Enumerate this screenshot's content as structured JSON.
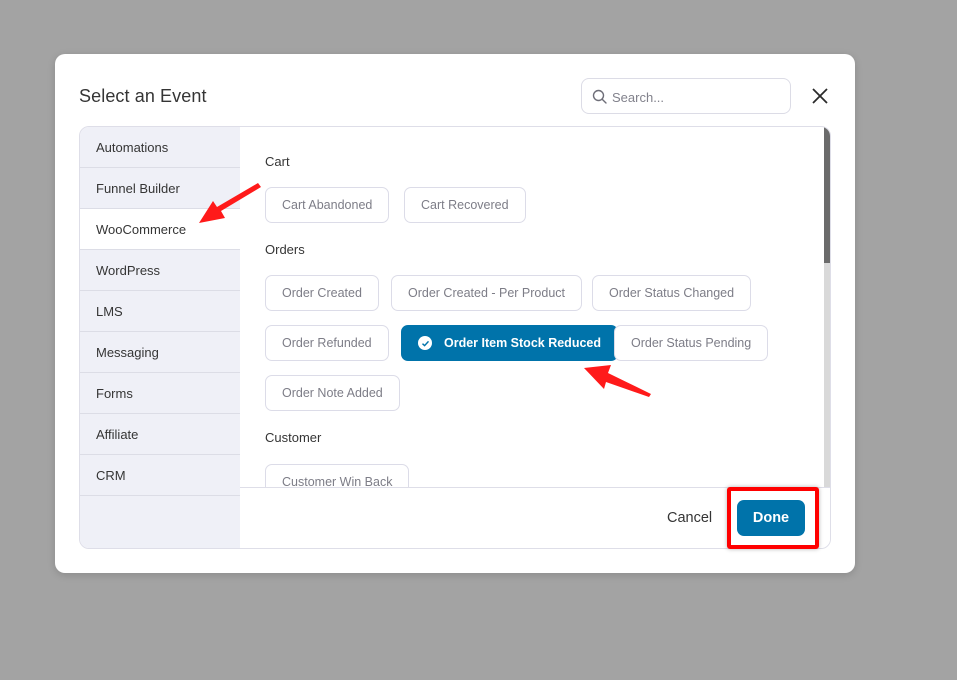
{
  "modal": {
    "title": "Select an Event",
    "search": {
      "placeholder": "Search...",
      "value": ""
    },
    "close_icon": "close-icon"
  },
  "sidebar": {
    "items": [
      {
        "label": "Automations",
        "active": false
      },
      {
        "label": "Funnel Builder",
        "active": false
      },
      {
        "label": "WooCommerce",
        "active": true
      },
      {
        "label": "WordPress",
        "active": false
      },
      {
        "label": "LMS",
        "active": false
      },
      {
        "label": "Messaging",
        "active": false
      },
      {
        "label": "Forms",
        "active": false
      },
      {
        "label": "Affiliate",
        "active": false
      },
      {
        "label": "CRM",
        "active": false
      }
    ]
  },
  "content": {
    "sections": [
      {
        "label": "Cart",
        "events": [
          "Cart Abandoned",
          "Cart Recovered"
        ]
      },
      {
        "label": "Orders",
        "events": [
          "Order Created",
          "Order Created - Per Product",
          "Order Status Changed",
          "Order Refunded",
          "Order Item Stock Reduced",
          "Order Status Pending",
          "Order Note Added"
        ]
      },
      {
        "label": "Customer",
        "events": [
          "Customer Win Back"
        ]
      }
    ],
    "selected_event": "Order Item Stock Reduced",
    "scroll_position": 0
  },
  "footer": {
    "cancel_label": "Cancel",
    "done_label": "Done"
  },
  "colors": {
    "primary": "#0073aa",
    "annotation": "#ff0000",
    "sidebar_bg": "#eff0f7",
    "backdrop": "#a3a3a3"
  }
}
